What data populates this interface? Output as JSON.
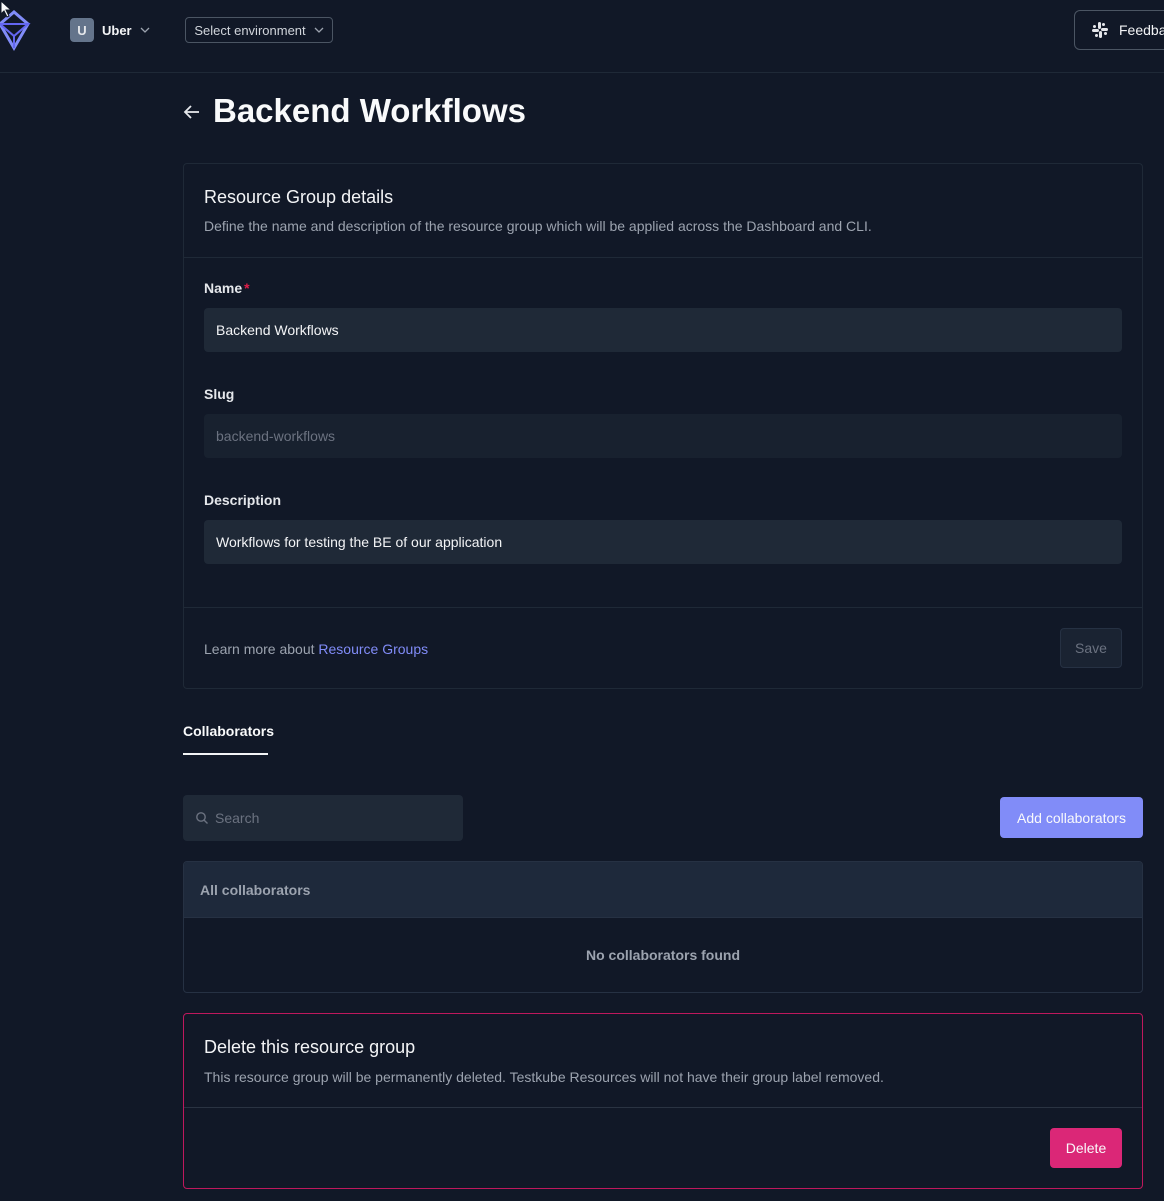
{
  "topbar": {
    "logo_icon": "testkube-cube-icon",
    "org_initial": "U",
    "org_name": "Uber",
    "env_select_label": "Select environment",
    "feedback_label": "Feedback",
    "slack_icon": "slack-icon"
  },
  "header": {
    "title": "Backend Workflows"
  },
  "details": {
    "title": "Resource Group details",
    "description": "Define the name and description of the resource group which will be applied across the Dashboard and CLI.",
    "name_label": "Name",
    "name_required": "*",
    "name_value": "Backend Workflows",
    "slug_label": "Slug",
    "slug_value": "backend-workflows",
    "description_label": "Description",
    "description_value": "Workflows for testing the BE of our application",
    "learn_prefix": "Learn more about ",
    "learn_link": "Resource Groups",
    "save_label": "Save"
  },
  "tabs": [
    {
      "label": "Collaborators",
      "active": true
    }
  ],
  "collaborators": {
    "search_placeholder": "Search",
    "add_label": "Add collaborators",
    "table_header": "All collaborators",
    "empty_text": "No collaborators found"
  },
  "danger": {
    "title": "Delete this resource group",
    "description": "This resource group will be permanently deleted. Testkube Resources will not have their group label removed.",
    "delete_label": "Delete",
    "accent": "#db2777"
  },
  "colors": {
    "background": "#111827",
    "accent": "#818cf8",
    "danger": "#db2777"
  }
}
